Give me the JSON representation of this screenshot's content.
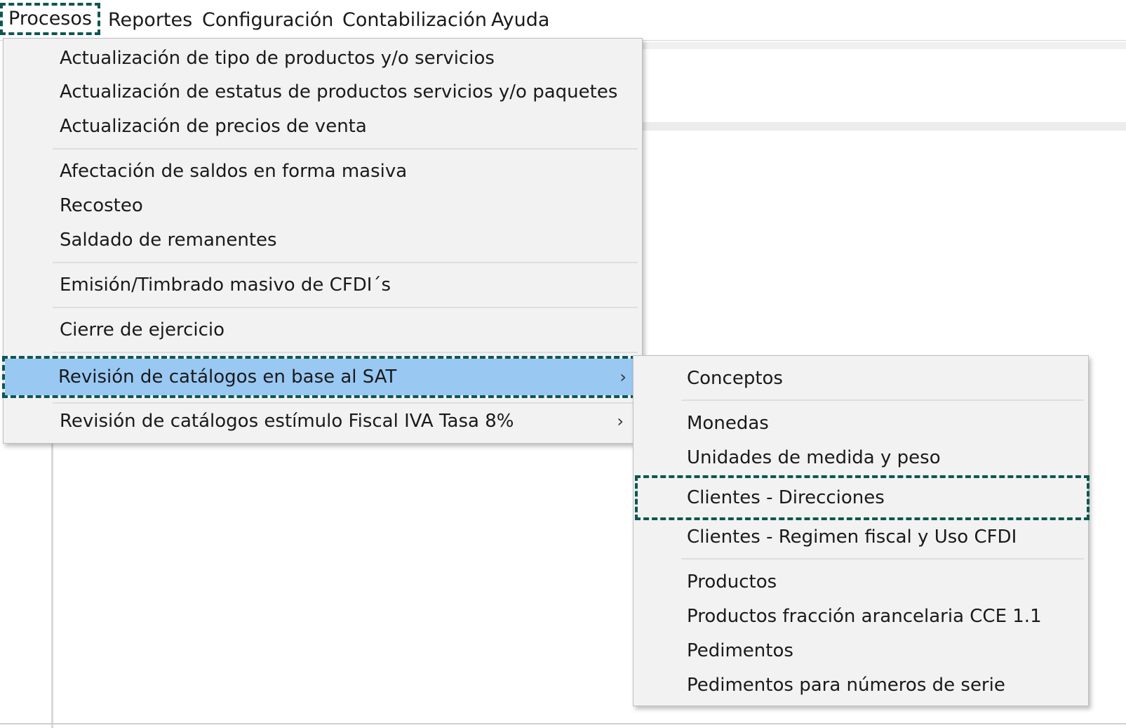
{
  "menubar": {
    "items": [
      "Procesos",
      "Reportes",
      "Configuración",
      "Contabilización",
      "Ayuda"
    ]
  },
  "procesos_menu": {
    "items": [
      "Actualización de tipo de productos y/o servicios",
      "Actualización de estatus de productos servicios y/o paquetes",
      "Actualización de precios de venta",
      "Afectación de saldos en forma masiva",
      "Recosteo",
      "Saldado de remanentes",
      "Emisión/Timbrado masivo de CFDI´s",
      "Cierre de ejercicio",
      "Revisión de catálogos en base al SAT",
      "Revisión de catálogos estímulo Fiscal IVA Tasa 8%"
    ],
    "submenu_arrow": "›"
  },
  "sat_submenu": {
    "items": [
      "Conceptos",
      "Monedas",
      "Unidades de medida y peso",
      "Clientes - Direcciones",
      "Clientes - Regimen fiscal y Uso CFDI",
      "Productos",
      "Productos fracción arancelaria CCE 1.1",
      "Pedimentos",
      "Pedimentos para números de serie"
    ]
  },
  "colors": {
    "highlight": "#99c9f3",
    "dashed_outline": "#0d5752",
    "menu_bg": "#f2f2f2"
  }
}
